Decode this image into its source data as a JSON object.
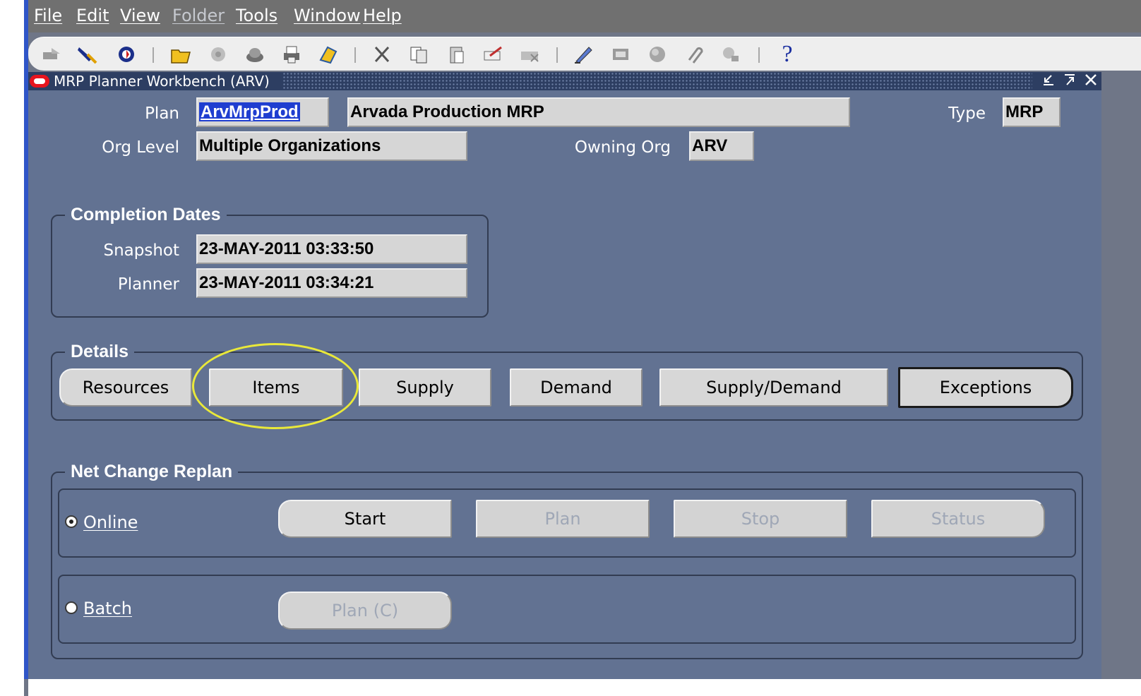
{
  "menu": {
    "items": [
      {
        "label": "File",
        "enabled": true
      },
      {
        "label": "Edit",
        "enabled": true
      },
      {
        "label": "View",
        "enabled": true
      },
      {
        "label": "Folder",
        "enabled": false
      },
      {
        "label": "Tools",
        "enabled": true
      },
      {
        "label": "Window",
        "enabled": true
      },
      {
        "label": "Help",
        "enabled": true
      }
    ]
  },
  "toolbar": {
    "icons": [
      "new-record-icon",
      "find-icon",
      "navigator-icon",
      "open-folder-icon",
      "save-icon",
      "next-step-icon",
      "print-icon",
      "close-form-icon",
      "cut-icon",
      "copy-icon",
      "paste-icon",
      "clear-record-icon",
      "delete-record-icon",
      "edit-field-icon",
      "zoom-icon",
      "translations-icon",
      "attachments-icon",
      "folder-tools-icon",
      "help-icon"
    ],
    "help_glyph": "?"
  },
  "window": {
    "title": "MRP Planner Workbench (ARV)",
    "title_bar_color": "#2d3e62",
    "logo_color": "#e8141e"
  },
  "header": {
    "plan_label": "Plan",
    "plan_code": "ArvMrpProd",
    "plan_name": "Arvada Production MRP",
    "type_label": "Type",
    "type_value": "MRP",
    "org_level_label": "Org Level",
    "org_level_value": "Multiple Organizations",
    "owning_org_label": "Owning Org",
    "owning_org_value": "ARV"
  },
  "completion_dates": {
    "title": "Completion Dates",
    "snapshot_label": "Snapshot",
    "snapshot_value": "23-MAY-2011 03:33:50",
    "planner_label": "Planner",
    "planner_value": "23-MAY-2011 03:34:21"
  },
  "details": {
    "title": "Details",
    "buttons": [
      "Resources",
      "Items",
      "Supply",
      "Demand",
      "Supply/Demand",
      "Exceptions"
    ],
    "highlighted": "Items",
    "highlight_color": "#e9e83a"
  },
  "net_change": {
    "title": "Net Change Replan",
    "online_label": "Online",
    "online_selected": true,
    "online_buttons": [
      {
        "label": "Start",
        "enabled": true
      },
      {
        "label": "Plan",
        "enabled": false
      },
      {
        "label": "Stop",
        "enabled": false
      },
      {
        "label": "Status",
        "enabled": false
      }
    ],
    "batch_label": "Batch",
    "batch_selected": false,
    "batch_button": {
      "label": "Plan (C)",
      "enabled": false
    }
  },
  "colors": {
    "form_bg": "#627292",
    "menu_bg": "#707070",
    "field_bg": "#d6d6d6",
    "selection": "#1f3ed0"
  }
}
